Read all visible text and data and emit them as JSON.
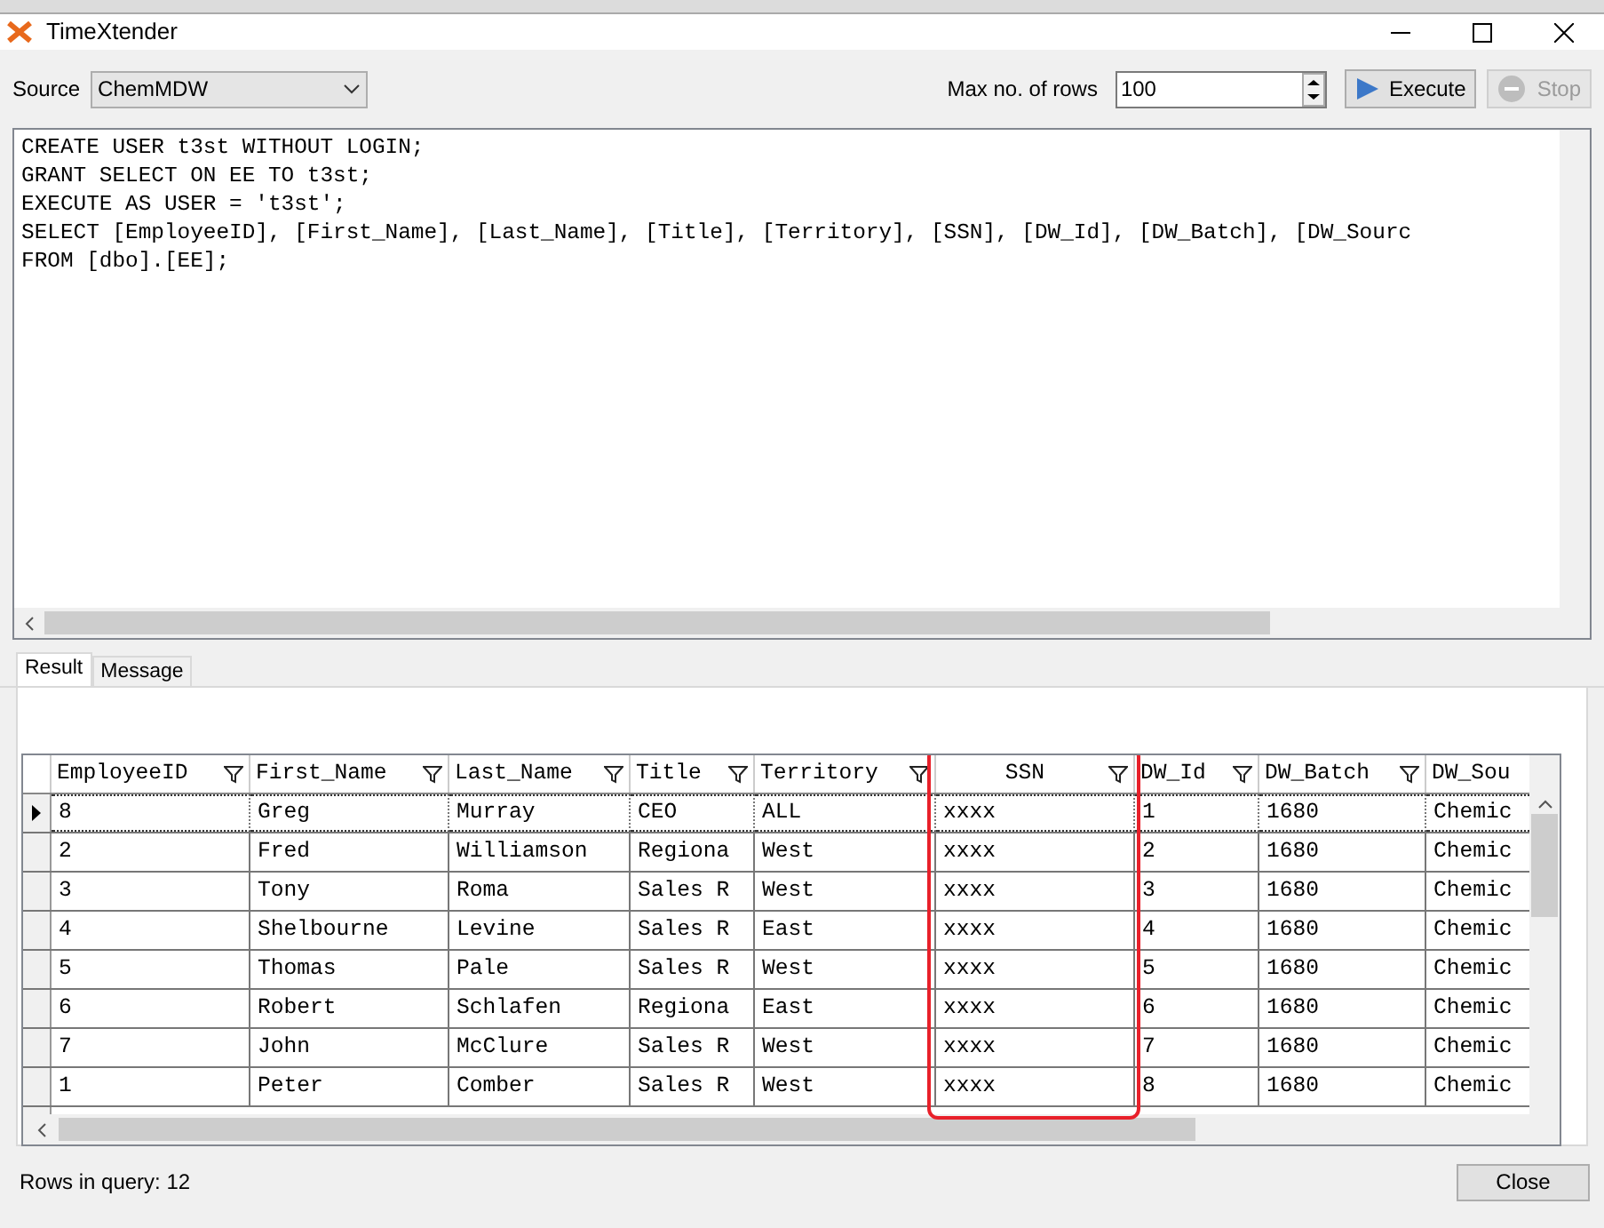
{
  "window": {
    "title": "TimeXtender"
  },
  "toolbar": {
    "source_label": "Source",
    "source_value": "ChemMDW",
    "max_rows_label": "Max no. of rows",
    "max_rows_value": "100",
    "execute_label": "Execute",
    "stop_label": "Stop",
    "stop_disabled": true
  },
  "editor": {
    "lines": [
      "CREATE USER t3st WITHOUT LOGIN;",
      "GRANT SELECT ON EE TO t3st;",
      "EXECUTE AS USER = 't3st';",
      "SELECT [EmployeeID], [First_Name], [Last_Name], [Title], [Territory], [SSN], [DW_Id], [DW_Batch], [DW_Sourc",
      "FROM [dbo].[EE];"
    ]
  },
  "tabs": [
    {
      "label": "Result",
      "selected": true
    },
    {
      "label": "Message",
      "selected": false
    }
  ],
  "table": {
    "columns": [
      {
        "label": "EmployeeID",
        "highlighted": false
      },
      {
        "label": "First_Name",
        "highlighted": false
      },
      {
        "label": "Last_Name",
        "highlighted": false
      },
      {
        "label": "Title",
        "highlighted": false
      },
      {
        "label": "Territory",
        "highlighted": false
      },
      {
        "label": "SSN",
        "highlighted": true
      },
      {
        "label": "DW_Id",
        "highlighted": false
      },
      {
        "label": "DW_Batch",
        "highlighted": false
      },
      {
        "label": "DW_Sou",
        "highlighted": false
      }
    ],
    "rows": [
      {
        "selected": true,
        "cells": [
          "8",
          "Greg",
          "Murray",
          "CEO",
          "ALL",
          "xxxx",
          "1",
          "1680",
          "Chemic"
        ]
      },
      {
        "selected": false,
        "cells": [
          "2",
          "Fred",
          "Williamson",
          "Regiona",
          "West",
          "xxxx",
          "2",
          "1680",
          "Chemic"
        ]
      },
      {
        "selected": false,
        "cells": [
          "3",
          "Tony",
          "Roma",
          "Sales R",
          "West",
          "xxxx",
          "3",
          "1680",
          "Chemic"
        ]
      },
      {
        "selected": false,
        "cells": [
          "4",
          "Shelbourne",
          "Levine",
          "Sales R",
          "East",
          "xxxx",
          "4",
          "1680",
          "Chemic"
        ]
      },
      {
        "selected": false,
        "cells": [
          "5",
          "Thomas",
          "Pale",
          "Sales R",
          "West",
          "xxxx",
          "5",
          "1680",
          "Chemic"
        ]
      },
      {
        "selected": false,
        "cells": [
          "6",
          "Robert",
          "Schlafen",
          "Regiona",
          "East",
          "xxxx",
          "6",
          "1680",
          "Chemic"
        ]
      },
      {
        "selected": false,
        "cells": [
          "7",
          "John",
          "McClure",
          "Sales R",
          "West",
          "xxxx",
          "7",
          "1680",
          "Chemic"
        ]
      },
      {
        "selected": false,
        "cells": [
          "1",
          "Peter",
          "Comber",
          "Sales R",
          "West",
          "xxxx",
          "8",
          "1680",
          "Chemic"
        ]
      }
    ]
  },
  "status_bar": {
    "text": "Rows in query: 12",
    "close_label": "Close"
  }
}
